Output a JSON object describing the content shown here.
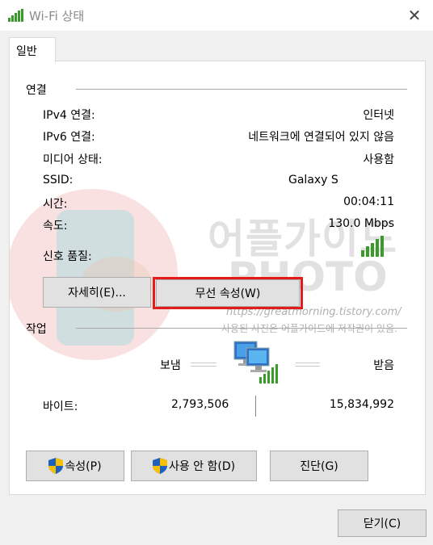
{
  "window": {
    "title": "Wi-Fi 상태",
    "close_label": "✕"
  },
  "tab": {
    "label": "일반"
  },
  "connection": {
    "section_label": "연결",
    "rows": [
      {
        "label": "IPv4 연결:",
        "value": "인터넷"
      },
      {
        "label": "IPv6 연결:",
        "value": "네트워크에 연결되어 있지 않음"
      },
      {
        "label": "미디어 상태:",
        "value": "사용함"
      },
      {
        "label": "SSID:",
        "value": "Galaxy S"
      },
      {
        "label": "시간:",
        "value": "00:04:11"
      },
      {
        "label": "속도:",
        "value": "130.0 Mbps"
      }
    ],
    "signal_label": "신호 품질:",
    "signal_icon": "signal-bars-icon"
  },
  "buttons": {
    "details": "자세히(E)...",
    "wireless_properties": "무선 속성(W)"
  },
  "activity": {
    "section_label": "작업",
    "sent_label": "보냄",
    "received_label": "받음",
    "bytes_label": "바이트:",
    "bytes_sent": "2,793,506",
    "bytes_received": "15,834,992"
  },
  "bottom_buttons": {
    "properties": "속성(P)",
    "disable": "사용 안 함(D)",
    "diagnose": "진단(G)",
    "close": "닫기(C)"
  },
  "watermark": {
    "line1": "어플가이드",
    "line2": "PHOTO",
    "url": "https://greatmorning.tistory.com/",
    "note": "사용된 사진은 어플가이드에 저작권이 있음."
  },
  "colors": {
    "highlight": "#e41b1b",
    "signal": "#3a9a2a",
    "shield_blue": "#1e5fbf",
    "shield_yellow": "#f5c000"
  }
}
